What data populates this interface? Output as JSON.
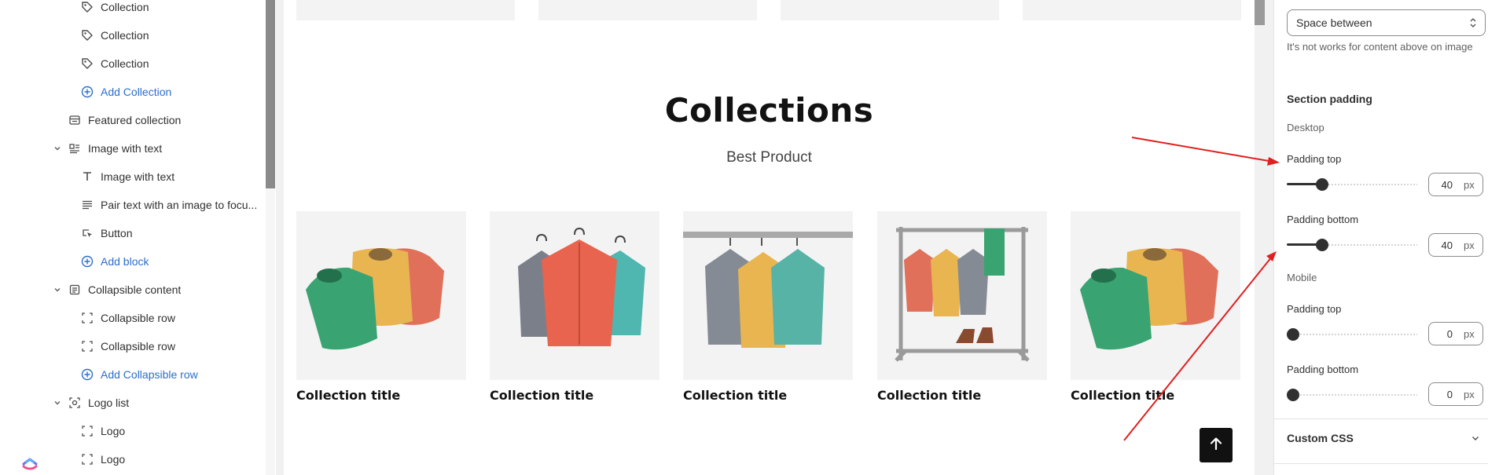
{
  "tree": {
    "items": [
      {
        "label": "Collection",
        "icon": "tag-icon",
        "type": "child"
      },
      {
        "label": "Collection",
        "icon": "tag-icon",
        "type": "child"
      },
      {
        "label": "Collection",
        "icon": "tag-icon",
        "type": "child"
      },
      {
        "label": "Add Collection",
        "icon": "plus-circle-icon",
        "type": "add"
      },
      {
        "label": "Featured collection",
        "icon": "featured-collection-icon",
        "type": "section"
      },
      {
        "label": "Image with text",
        "icon": "image-with-text-icon",
        "type": "section-open"
      },
      {
        "label": "Image with text",
        "icon": "heading-icon",
        "type": "child"
      },
      {
        "label": "Pair text with an image to focu...",
        "icon": "text-lines-icon",
        "type": "child"
      },
      {
        "label": "Button",
        "icon": "button-icon",
        "type": "child"
      },
      {
        "label": "Add block",
        "icon": "plus-circle-icon",
        "type": "add"
      },
      {
        "label": "Collapsible content",
        "icon": "collapsible-content-icon",
        "type": "section-open"
      },
      {
        "label": "Collapsible row",
        "icon": "block-frame-icon",
        "type": "child"
      },
      {
        "label": "Collapsible row",
        "icon": "block-frame-icon",
        "type": "child"
      },
      {
        "label": "Add Collapsible row",
        "icon": "plus-circle-icon",
        "type": "add"
      },
      {
        "label": "Logo list",
        "icon": "logo-list-icon",
        "type": "section-open"
      },
      {
        "label": "Logo",
        "icon": "block-frame-icon",
        "type": "child"
      },
      {
        "label": "Logo",
        "icon": "block-frame-icon",
        "type": "child"
      }
    ]
  },
  "preview": {
    "heading": "Collections",
    "subheading": "Best Product",
    "cards": [
      {
        "title": "Collection title",
        "art": "folded-shirts"
      },
      {
        "title": "Collection title",
        "art": "hanging-shirts"
      },
      {
        "title": "Collection title",
        "art": "rail-sweaters"
      },
      {
        "title": "Collection title",
        "art": "clothes-rack"
      },
      {
        "title": "Collection title",
        "art": "folded-shirts"
      }
    ]
  },
  "settings": {
    "content_position_value": "Space between",
    "content_position_help": "It's not works for content above on image",
    "section_padding_title": "Section padding",
    "desktop_label": "Desktop",
    "mobile_label": "Mobile",
    "sliders": [
      {
        "label": "Padding top",
        "value": "40",
        "unit": "px",
        "fraction": 0.27
      },
      {
        "label": "Padding bottom",
        "value": "40",
        "unit": "px",
        "fraction": 0.27
      },
      {
        "label": "Padding top",
        "value": "0",
        "unit": "px",
        "fraction": 0
      },
      {
        "label": "Padding bottom",
        "value": "0",
        "unit": "px",
        "fraction": 0
      }
    ],
    "custom_css_label": "Custom CSS"
  },
  "colors": {
    "link_blue": "#2c6ecb",
    "annotation_red": "#e02020",
    "slider_dark": "#303030"
  }
}
